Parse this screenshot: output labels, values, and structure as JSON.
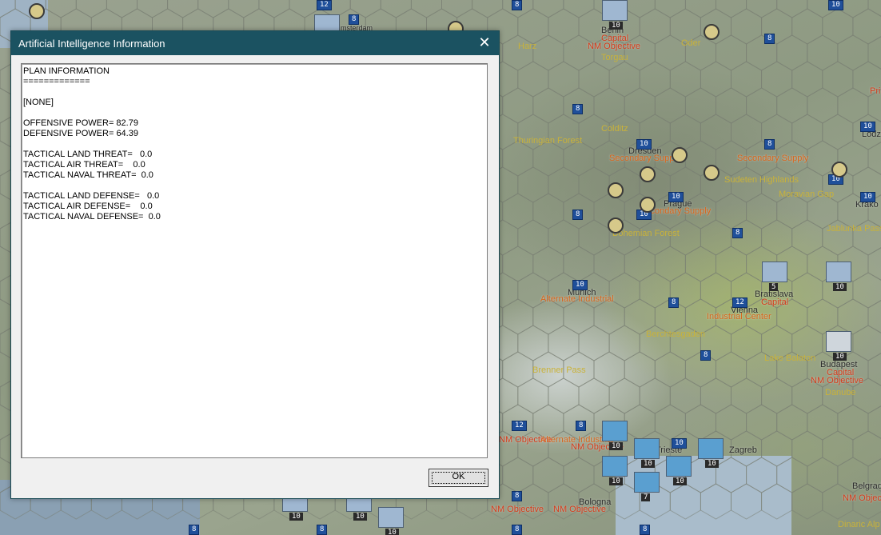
{
  "dialog": {
    "title": "Artificial Intelligence Information",
    "close_glyph": "✕",
    "lines": [
      "PLAN INFORMATION",
      "=============",
      "",
      "[NONE]",
      "",
      "OFFENSIVE POWER= 82.79",
      "DEFENSIVE POWER= 64.39",
      "",
      "TACTICAL LAND THREAT=   0.0",
      "TACTICAL AIR THREAT=    0.0",
      "TACTICAL NAVAL THREAT=  0.0",
      "",
      "TACTICAL LAND DEFENSE=   0.0",
      "TACTICAL AIR DEFENSE=    0.0",
      "TACTICAL NAVAL DEFENSE=  0.0"
    ],
    "ok_label": "OK"
  },
  "map": {
    "labels": {
      "berlin": "Berlin",
      "berlin_capital": "Capital",
      "berlin_nm": "NM Objective",
      "torgau": "Torgau",
      "harz": "Harz",
      "oder": "Oder",
      "colditz": "Colditz",
      "thuringian": "Thuringian Forest",
      "dresden": "Dresden",
      "dresden_supply": "Secondary Supply",
      "secondary_supply_east": "Secondary Supply",
      "sudeten": "Sudeten Highlands",
      "moravian": "Moravian Gap",
      "prague": "Prague",
      "prague_supply": "Secondary Supply",
      "bohemian": "Bohemian Forest",
      "jablunka": "Jablunka Pass",
      "krakow": "Krako",
      "lodz": "Lodz",
      "munich": "Munich",
      "munich_ind": "Alternate Industrial",
      "bratislava": "Bratislava",
      "bratislava_capital": "Capital",
      "vienna": "Vienna",
      "vienna_ind": "Industrial Center",
      "berchtesgaden": "Berchtesgaden",
      "brenner": "Brenner Pass",
      "balaton": "Lake Balaton",
      "budapest": "Budapest",
      "budapest_capital": "Capital",
      "budapest_nm": "NM Objective",
      "danube": "Danube",
      "trieste": "Trieste",
      "zagreb": "Zagreb",
      "milan_nm": "NM Objective",
      "milan_alt": "Alternate Industrial",
      "nm_objective_s": "NM Objective",
      "bologna": "Bologna",
      "nm_s1": "NM Objective",
      "nm_s2": "NM Objective",
      "belgrade": "Belgrad",
      "belgrade_nm": "NM Objective",
      "dinaric": "Dinaric Alp",
      "amsterdam": "msterdam",
      "pri": "Pri"
    },
    "badges": [
      "8",
      "8",
      "8",
      "8",
      "8",
      "8",
      "10",
      "10",
      "10",
      "10",
      "10",
      "10",
      "10",
      "10",
      "10",
      "12",
      "12",
      "8",
      "8",
      "8",
      "8",
      "8",
      "8",
      "12",
      "8",
      "8",
      "8",
      "8",
      "8"
    ],
    "strengths": [
      "10",
      "10",
      "5",
      "10",
      "10",
      "10",
      "10",
      "10",
      "10",
      "10",
      "10",
      "7",
      "10",
      "10",
      "10"
    ]
  },
  "colors": {
    "titlebar": "#1b5261",
    "nm_objective": "#d63a1a",
    "supply": "#d8651b",
    "terrain_label": "#c9b23a",
    "unit_badge": "#1f4f9a"
  }
}
